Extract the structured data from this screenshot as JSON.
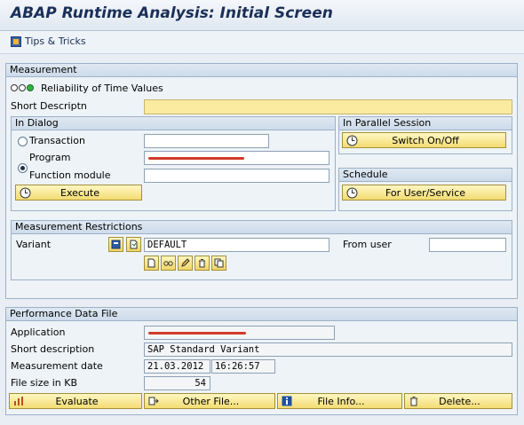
{
  "window": {
    "title": "ABAP Runtime Analysis: Initial Screen"
  },
  "appbar": {
    "tips_label": "Tips & Tricks"
  },
  "measurement": {
    "header": "Measurement",
    "reliability_label": "Reliability of Time Values",
    "short_descr_label": "Short Descriptn",
    "short_descr_value": "",
    "in_dialog": {
      "header": "In Dialog",
      "transaction_label": "Transaction",
      "transaction_value": "",
      "program_label": "Program",
      "function_module_label": "Function module",
      "function_module_value": "",
      "selected_option": "Program",
      "execute_label": "Execute"
    },
    "parallel": {
      "header": "In Parallel Session",
      "switch_label": "Switch On/Off"
    },
    "schedule": {
      "header": "Schedule",
      "for_user_label": "For User/Service"
    }
  },
  "restrictions": {
    "header": "Measurement Restrictions",
    "variant_label": "Variant",
    "variant_value": "DEFAULT",
    "from_user_label": "From user",
    "from_user_value": ""
  },
  "perf_file": {
    "header": "Performance Data File",
    "application_label": "Application",
    "short_desc_label": "Short description",
    "short_desc_value": "SAP Standard Variant",
    "date_label": "Measurement date",
    "date_value": "21.03.2012",
    "time_value": "16:26:57",
    "size_label": "File size in KB",
    "size_value": "54",
    "evaluate_label": "Evaluate",
    "other_file_label": "Other File...",
    "file_info_label": "File Info...",
    "delete_label": "Delete..."
  },
  "colors": {
    "accent": "#1a2f58",
    "button": "#f3dc73",
    "required": "#fbeba1",
    "redaction": "#d23a2a"
  }
}
